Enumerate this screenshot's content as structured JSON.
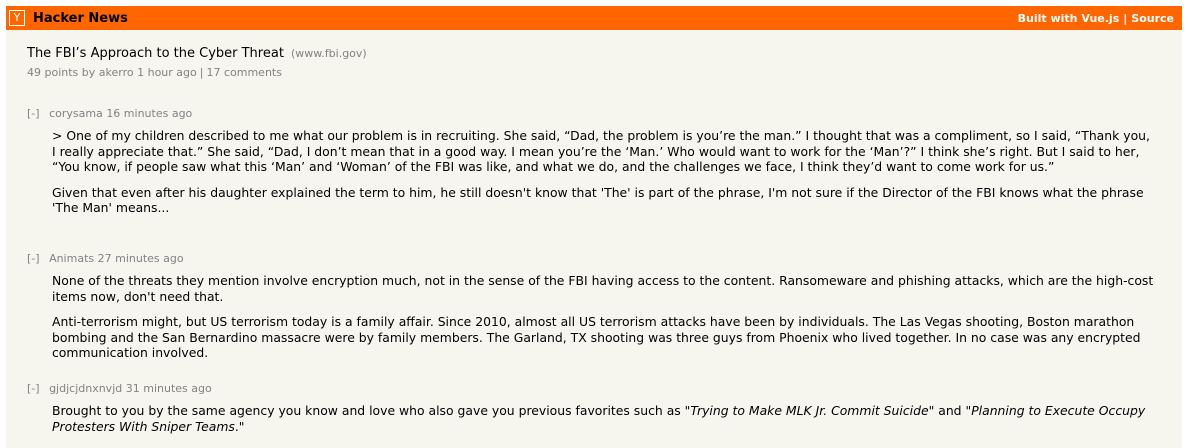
{
  "header": {
    "logo": "Y",
    "site_name": "Hacker News",
    "built_with": "Built with Vue.js",
    "separator": "|",
    "source": "Source"
  },
  "story": {
    "title": "The FBI’s Approach to the Cyber Threat",
    "domain": "(www.fbi.gov)",
    "points": "49 points by",
    "author": "akerro",
    "age": "1 hour ago",
    "separator": "|",
    "comments": "17 comments"
  },
  "comments": [
    {
      "toggle": "[-]",
      "author": "corysama",
      "age": "16 minutes ago",
      "paragraphs": [
        "> One of my children described to me what our problem is in recruiting. She said, “Dad, the problem is you’re the man.” I thought that was a compliment, so I said, “Thank you, I really appreciate that.” She said, “Dad, I don’t mean that in a good way. I mean you’re the ‘Man.’ Who would want to work for the ‘Man’?” I think she’s right. But I said to her, “You know, if people saw what this ‘Man’ and ‘Woman’ of the FBI was like, and what we do, and the challenges we face, I think they’d want to come work for us.”",
        "Given that even after his daughter explained the term to him, he still doesn't know that 'The' is part of the phrase, I'm not sure if the Director of the FBI knows what the phrase 'The Man' means..."
      ]
    },
    {
      "toggle": "[-]",
      "author": "Animats",
      "age": "27 minutes ago",
      "paragraphs": [
        "None of the threats they mention involve encryption much, not in the sense of the FBI having access to the content. Ransomeware and phishing attacks, which are the high-cost items now, don't need that.",
        "Anti-terrorism might, but US terrorism today is a family affair. Since 2010, almost all US terrorism attacks have been by individuals. The Las Vegas shooting, Boston marathon bombing and the San Bernardino massacre were by family members. The Garland, TX shooting was three guys from Phoenix who lived together. In no case was any encrypted communication involved."
      ]
    },
    {
      "toggle": "[-]",
      "author": "gjdjcjdnxnvjd",
      "age": "31 minutes ago",
      "text_before": "Brought to you by the same agency you know and love who also gave you previous favorites such as \"",
      "italic_1": "Trying to Make MLK Jr. Commit Suicide",
      "text_middle": "\" and \"",
      "italic_2": "Planning to Execute Occupy Protesters With Sniper Teams",
      "text_after": ".\""
    }
  ],
  "colors": {
    "header_bg": "#ff6600",
    "page_bg": "#f6f6ef",
    "meta_text": "#828282"
  }
}
